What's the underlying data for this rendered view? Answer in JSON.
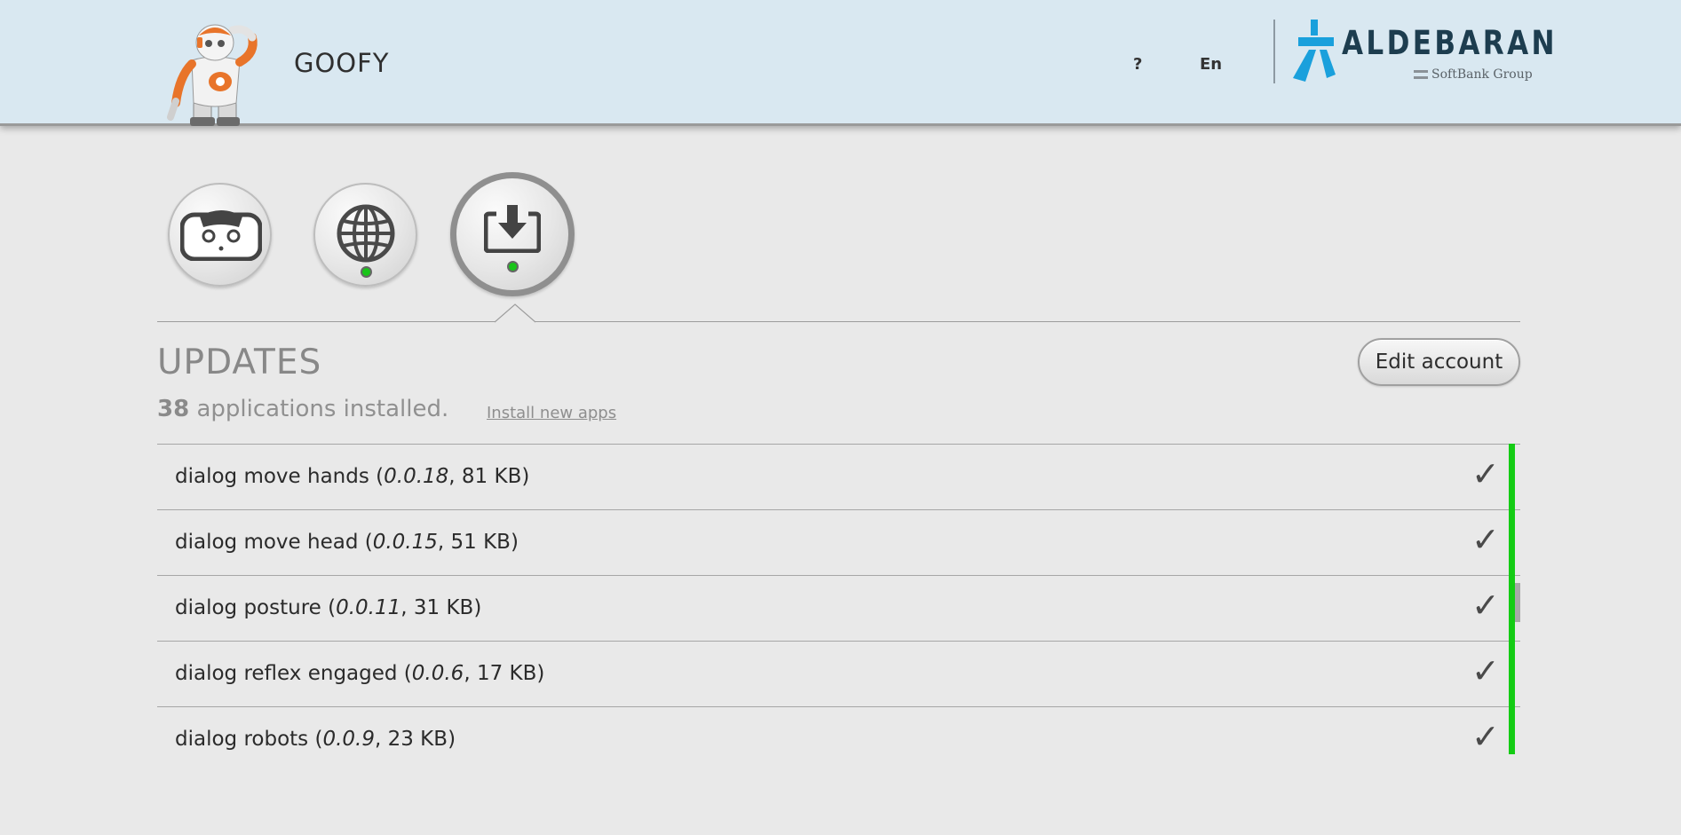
{
  "header": {
    "robot_name": "GOOFY",
    "help_label": "?",
    "language_label": "En",
    "brand_name": "ALDEBARAN",
    "brand_group": "SoftBank Group",
    "brand_color": "#1d3d4f",
    "brand_mark_color": "#1aa0dc",
    "background_color": "#d9e8f1"
  },
  "sections": [
    {
      "name": "robot",
      "icon": "robot-face-icon",
      "status": "none",
      "active": false
    },
    {
      "name": "network",
      "icon": "globe-icon",
      "status": "ok",
      "active": false
    },
    {
      "name": "updates",
      "icon": "download-icon",
      "status": "ok",
      "active": true
    }
  ],
  "page": {
    "title": "UPDATES",
    "apps_count": "38",
    "apps_count_suffix": " applications installed.",
    "install_link": "Install new apps",
    "edit_account_label": "Edit account"
  },
  "apps": [
    {
      "name": "dialog move hands",
      "version": "0.0.18",
      "size": "81 KB",
      "status": "✓"
    },
    {
      "name": "dialog move head",
      "version": "0.0.15",
      "size": "51 KB",
      "status": "✓"
    },
    {
      "name": "dialog posture",
      "version": "0.0.11",
      "size": "31 KB",
      "status": "✓"
    },
    {
      "name": "dialog reflex engaged",
      "version": "0.0.6",
      "size": "17 KB",
      "status": "✓"
    },
    {
      "name": "dialog robots",
      "version": "0.0.9",
      "size": "23 KB",
      "status": "✓"
    }
  ],
  "colors": {
    "status_ok": "#19c419",
    "installed_bar": "#14cc14",
    "page_background": "#e9e9e9"
  }
}
